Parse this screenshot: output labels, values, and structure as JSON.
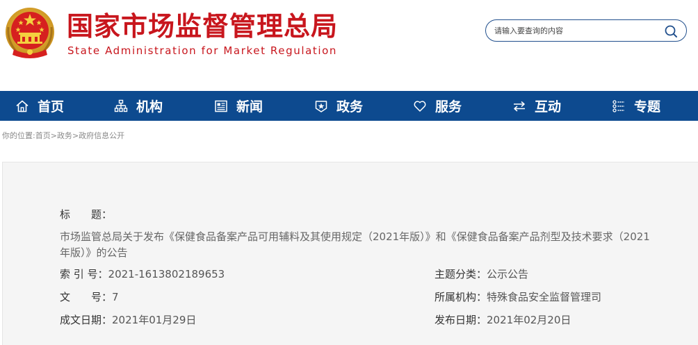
{
  "header": {
    "title_cn": "国家市场监督管理总局",
    "title_en": "State Administration for Market Regulation",
    "emblem_icon": "national-emblem-icon"
  },
  "search": {
    "placeholder": "请输入要查询的内容",
    "icon": "search-icon"
  },
  "nav": {
    "items": [
      {
        "label": "首页",
        "icon": "home-icon"
      },
      {
        "label": "机构",
        "icon": "org-chart-icon"
      },
      {
        "label": "新闻",
        "icon": "news-icon"
      },
      {
        "label": "政务",
        "icon": "government-affairs-icon"
      },
      {
        "label": "服务",
        "icon": "heart-icon"
      },
      {
        "label": "互动",
        "icon": "exchange-arrows-icon"
      },
      {
        "label": "专题",
        "icon": "topics-list-icon"
      }
    ]
  },
  "breadcrumb": {
    "prefix": "你的位置:",
    "items": [
      "首页",
      "政务",
      "政府信息公开"
    ],
    "separator": ">"
  },
  "doc_info": {
    "title_label": "标　　题：",
    "title_value": "市场监管总局关于发布《保健食品备案产品可用辅料及其使用规定（2021年版）》和《保健食品备案产品剂型及技术要求（2021年版）》的公告",
    "index_label": "索 引 号：",
    "index_value": "2021-1613802189653",
    "number_label": "文　　号：",
    "number_value": "7",
    "created_label": "成文日期：",
    "created_value": "2021年01月29日",
    "topic_label": "主题分类：",
    "topic_value": "公示公告",
    "org_label": "所属机构：",
    "org_value": "特殊食品安全监督管理司",
    "published_label": "发布日期：",
    "published_value": "2021年02月20日"
  },
  "colors": {
    "brand_red": "#c8161d",
    "nav_blue": "#0d4a8f",
    "panel_bg": "#f5f5f5"
  }
}
